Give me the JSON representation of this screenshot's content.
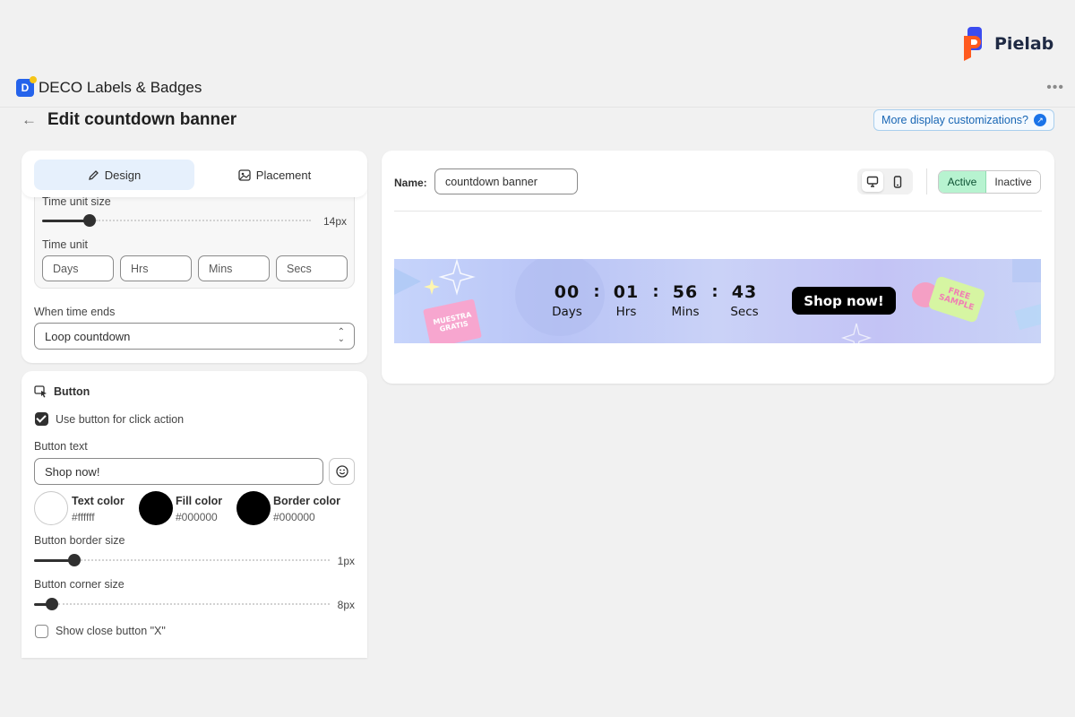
{
  "brand": {
    "name": "Pielab"
  },
  "app": {
    "logo_letter": "D",
    "name": "DECO Labels & Badges",
    "more_menu": "•••"
  },
  "page": {
    "back": "←",
    "title": "Edit countdown banner",
    "more_link": "More display customizations?"
  },
  "tabs": [
    {
      "label": "Design",
      "active": true
    },
    {
      "label": "Placement",
      "active": false
    }
  ],
  "design": {
    "time_unit_size": {
      "label": "Time unit size",
      "value": "14px",
      "fraction": 0.16
    },
    "time_unit": {
      "label": "Time unit",
      "units": [
        "Days",
        "Hrs",
        "Mins",
        "Secs"
      ]
    },
    "when_time_ends": {
      "label": "When time ends",
      "selected": "Loop countdown"
    }
  },
  "button_section": {
    "title": "Button",
    "use_button": {
      "label": "Use button for click action",
      "checked": true
    },
    "button_text": {
      "label": "Button text",
      "value": "Shop now!"
    },
    "colors": [
      {
        "name": "Text color",
        "hex": "#ffffff"
      },
      {
        "name": "Fill color",
        "hex": "#000000"
      },
      {
        "name": "Border color",
        "hex": "#000000"
      }
    ],
    "border_size": {
      "label": "Button border size",
      "value": "1px",
      "fraction": 0.12
    },
    "corner_size": {
      "label": "Button corner size",
      "value": "8px",
      "fraction": 0.04
    },
    "show_close": {
      "label": "Show close button \"X\"",
      "checked": false
    }
  },
  "preview": {
    "name_label": "Name:",
    "name_value": "countdown banner",
    "device_selected": "desktop",
    "status": {
      "active": "Active",
      "inactive": "Inactive",
      "current": "Active"
    },
    "banner": {
      "countdown": [
        {
          "num": "00",
          "label": "Days"
        },
        {
          "num": "01",
          "label": "Hrs"
        },
        {
          "num": "56",
          "label": "Mins"
        },
        {
          "num": "43",
          "label": "Secs"
        }
      ],
      "separator": ":",
      "button": "Shop now!",
      "sticker_left": "MUESTRA GRATIS",
      "sticker_right": "FREE SAMPLE"
    }
  },
  "colors": {
    "accent_blue": "#2563eb",
    "active_green": "#b7f3d0",
    "tab_active": "#e6f0fc"
  }
}
